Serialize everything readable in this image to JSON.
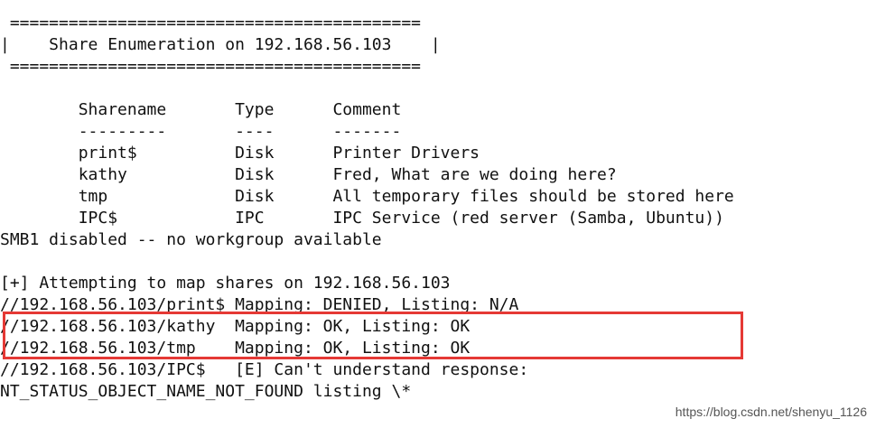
{
  "header": {
    "border_top": " ==========================================",
    "title": "|    Share Enumeration on 192.168.56.103    |",
    "border_bottom": " =========================================="
  },
  "share_table": {
    "header": "        Sharename       Type      Comment",
    "underline": "        ---------       ----      -------",
    "rows": [
      "        print$          Disk      Printer Drivers",
      "        kathy           Disk      Fred, What are we doing here?",
      "        tmp             Disk      All temporary files should be stored here",
      "        IPC$            IPC       IPC Service (red server (Samba, Ubuntu))"
    ]
  },
  "status_smb1": "SMB1 disabled -- no workgroup available",
  "mapping": {
    "attempt": "[+] Attempting to map shares on 192.168.56.103",
    "results": [
      "//192.168.56.103/print$ Mapping: DENIED, Listing: N/A",
      "//192.168.56.103/kathy  Mapping: OK, Listing: OK",
      "//192.168.56.103/tmp    Mapping: OK, Listing: OK",
      "//192.168.56.103/IPC$   [E] Can't understand response:",
      "NT_STATUS_OBJECT_NAME_NOT_FOUND listing \\*"
    ]
  },
  "watermark": "https://blog.csdn.net/shenyu_1126",
  "colors": {
    "highlight_border": "#e53935",
    "text": "#111111",
    "background": "#ffffff"
  }
}
